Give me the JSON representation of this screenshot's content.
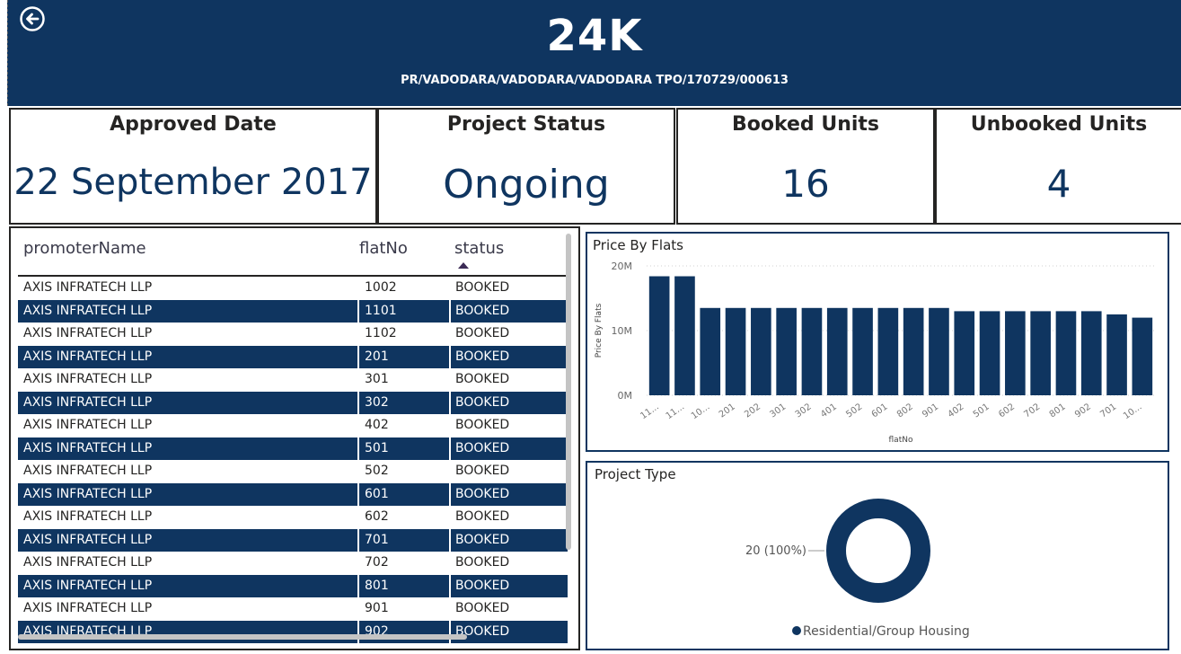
{
  "header": {
    "big_value": "24K",
    "registration_no": "PR/VADODARA/VADODARA/VADODARA TPO/170729/000613",
    "back_icon": "back-arrow-icon"
  },
  "cards": [
    {
      "title": "Approved Date",
      "value": "22 September 2017"
    },
    {
      "title": "Project Status",
      "value": "Ongoing"
    },
    {
      "title": "Booked Units",
      "value": "16"
    },
    {
      "title": "Unbooked Units",
      "value": "4"
    }
  ],
  "table": {
    "columns": [
      "promoterName",
      "flatNo",
      "status"
    ],
    "sort_column": "status",
    "rows": [
      {
        "promoter": "AXIS INFRATECH LLP",
        "flat": "1002",
        "status": "BOOKED"
      },
      {
        "promoter": "AXIS INFRATECH LLP",
        "flat": "1101",
        "status": "BOOKED"
      },
      {
        "promoter": "AXIS INFRATECH LLP",
        "flat": "1102",
        "status": "BOOKED"
      },
      {
        "promoter": "AXIS INFRATECH LLP",
        "flat": "201",
        "status": "BOOKED"
      },
      {
        "promoter": "AXIS INFRATECH LLP",
        "flat": "301",
        "status": "BOOKED"
      },
      {
        "promoter": "AXIS INFRATECH LLP",
        "flat": "302",
        "status": "BOOKED"
      },
      {
        "promoter": "AXIS INFRATECH LLP",
        "flat": "402",
        "status": "BOOKED"
      },
      {
        "promoter": "AXIS INFRATECH LLP",
        "flat": "501",
        "status": "BOOKED"
      },
      {
        "promoter": "AXIS INFRATECH LLP",
        "flat": "502",
        "status": "BOOKED"
      },
      {
        "promoter": "AXIS INFRATECH LLP",
        "flat": "601",
        "status": "BOOKED"
      },
      {
        "promoter": "AXIS INFRATECH LLP",
        "flat": "602",
        "status": "BOOKED"
      },
      {
        "promoter": "AXIS INFRATECH LLP",
        "flat": "701",
        "status": "BOOKED"
      },
      {
        "promoter": "AXIS INFRATECH LLP",
        "flat": "702",
        "status": "BOOKED"
      },
      {
        "promoter": "AXIS INFRATECH LLP",
        "flat": "801",
        "status": "BOOKED"
      },
      {
        "promoter": "AXIS INFRATECH LLP",
        "flat": "901",
        "status": "BOOKED"
      },
      {
        "promoter": "AXIS INFRATECH LLP",
        "flat": "902",
        "status": "BOOKED"
      }
    ]
  },
  "colors": {
    "accent": "#0f3560",
    "text": "#252423",
    "white": "#ffffff"
  },
  "chart_data": [
    {
      "type": "bar",
      "title": "Price By Flats",
      "xlabel": "flatNo",
      "ylabel": "Price By Flats",
      "ylim": [
        0,
        20000000
      ],
      "yticks": [
        "0M",
        "10M",
        "20M"
      ],
      "categories": [
        "11...",
        "11...",
        "10...",
        "201",
        "202",
        "301",
        "302",
        "401",
        "502",
        "601",
        "802",
        "901",
        "402",
        "501",
        "602",
        "702",
        "801",
        "902",
        "701",
        "10..."
      ],
      "values": [
        18400000,
        18400000,
        13500000,
        13500000,
        13500000,
        13500000,
        13500000,
        13500000,
        13500000,
        13500000,
        13500000,
        13500000,
        13000000,
        13000000,
        13000000,
        13000000,
        13000000,
        13000000,
        12500000,
        12000000
      ],
      "grid": true
    },
    {
      "type": "pie",
      "variant": "donut",
      "title": "Project Type",
      "slices": [
        {
          "label": "Residential/Group Housing",
          "value": 20,
          "data_label": "20 (100%)"
        }
      ],
      "legend": "bottom"
    }
  ]
}
